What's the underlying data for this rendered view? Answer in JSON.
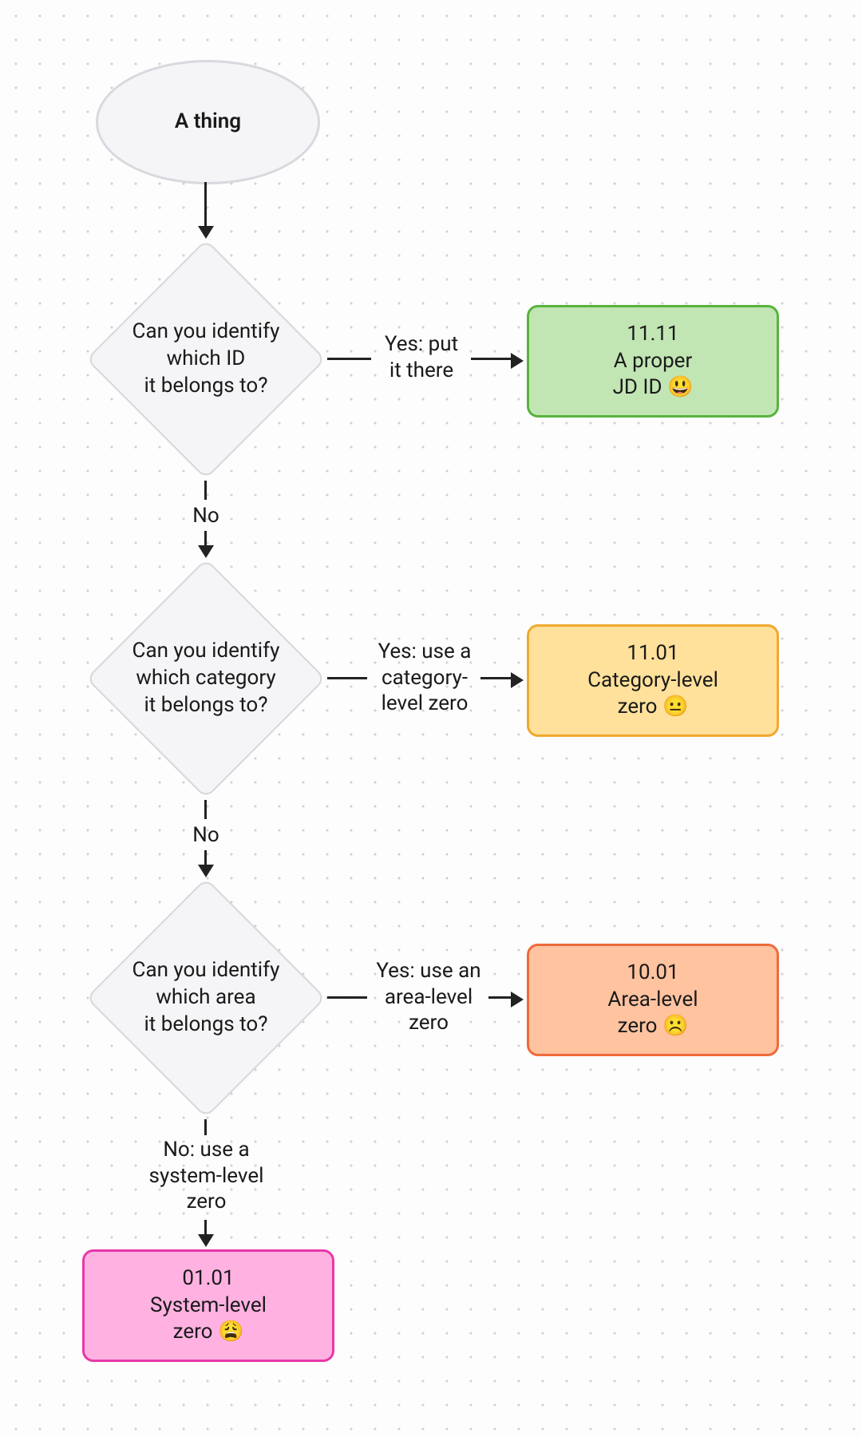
{
  "start": "A thing",
  "decisions": {
    "d1": {
      "question": "Can you identify\nwhich ID\nit belongs to?",
      "yes_label": "Yes: put\nit there",
      "no_label": "No"
    },
    "d2": {
      "question": "Can you identify\nwhich category\nit belongs to?",
      "yes_label": "Yes: use a\ncategory-\nlevel zero",
      "no_label": "No"
    },
    "d3": {
      "question": "Can you identify\nwhich area\nit belongs to?",
      "yes_label": "Yes: use an\narea-level\nzero",
      "no_label": "No: use a\nsystem-level\nzero"
    }
  },
  "results": {
    "r1": {
      "code": "11.11",
      "text": "A proper\nJD ID 😃"
    },
    "r2": {
      "code": "11.01",
      "text": "Category-level\nzero 😐"
    },
    "r3": {
      "code": "10.01",
      "text": "Area-level\nzero ☹️"
    },
    "r4": {
      "code": "01.01",
      "text": "System-level\nzero 😩"
    }
  }
}
